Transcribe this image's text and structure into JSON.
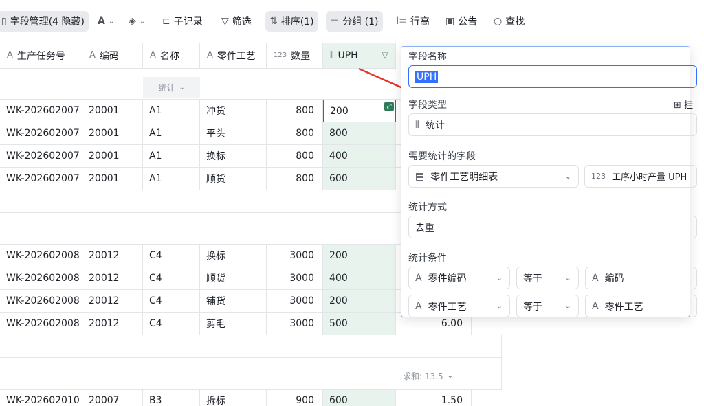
{
  "toolbar": {
    "field_manage": "字段管理(4 隐藏)",
    "subrecord": "子记录",
    "filter": "筛选",
    "sort": "排序(1)",
    "group": "分组 (1)",
    "row_height": "行高",
    "notice": "公告",
    "find": "查找"
  },
  "columns": {
    "task": "生产任务号",
    "code": "编码",
    "name": "名称",
    "process": "零件工艺",
    "qty_type": "123",
    "qty": "数量",
    "uph": "UPH"
  },
  "stats_label": "统计",
  "sum_label": "求和: 13.5",
  "groups": [
    {
      "rows": [
        {
          "task": "WK-202602007",
          "code": "20001",
          "name": "A1",
          "process": "冲货",
          "qty": "800",
          "uph": "200"
        },
        {
          "task": "WK-202602007",
          "code": "20001",
          "name": "A1",
          "process": "平头",
          "qty": "800",
          "uph": "800"
        },
        {
          "task": "WK-202602007",
          "code": "20001",
          "name": "A1",
          "process": "换标",
          "qty": "800",
          "uph": "400"
        },
        {
          "task": "WK-202602007",
          "code": "20001",
          "name": "A1",
          "process": "顺货",
          "qty": "800",
          "uph": "600"
        }
      ]
    },
    {
      "rows": [
        {
          "task": "WK-202602008",
          "code": "20012",
          "name": "C4",
          "process": "换标",
          "qty": "3000",
          "uph": "200"
        },
        {
          "task": "WK-202602008",
          "code": "20012",
          "name": "C4",
          "process": "顺货",
          "qty": "3000",
          "uph": "400"
        },
        {
          "task": "WK-202602008",
          "code": "20012",
          "name": "C4",
          "process": "铺货",
          "qty": "3000",
          "uph": "200"
        },
        {
          "task": "WK-202602008",
          "code": "20012",
          "name": "C4",
          "process": "剪毛",
          "qty": "3000",
          "uph": "500",
          "extra": "6.00"
        }
      ]
    },
    {
      "rows": [
        {
          "task": "WK-202602010",
          "code": "20007",
          "name": "B3",
          "process": "拆标",
          "qty": "900",
          "uph": "600",
          "extra": "1.50"
        }
      ]
    }
  ],
  "panel": {
    "field_name_label": "字段名称",
    "field_name_value": "UPH",
    "field_type_label": "字段类型",
    "field_type_value": "统计",
    "field_type_extra": "挂",
    "stat_field_label": "需要统计的字段",
    "stat_table": "零件工艺明细表",
    "stat_field": "工序小时产量 UPH",
    "stat_field_prefix": "123",
    "method_label": "统计方式",
    "method_value": "去重",
    "cond_label": "统计条件",
    "conditions": [
      {
        "left": "零件编码",
        "op": "等于",
        "right": "编码"
      },
      {
        "left": "零件工艺",
        "op": "等于",
        "right": "零件工艺"
      }
    ]
  },
  "colors": {
    "uph_bg": "#e9f3ee",
    "selected_border": "#2f7a58",
    "panel_border": "#8fb0f4",
    "accent": "#3370ff",
    "arrow": "#e8332a"
  }
}
